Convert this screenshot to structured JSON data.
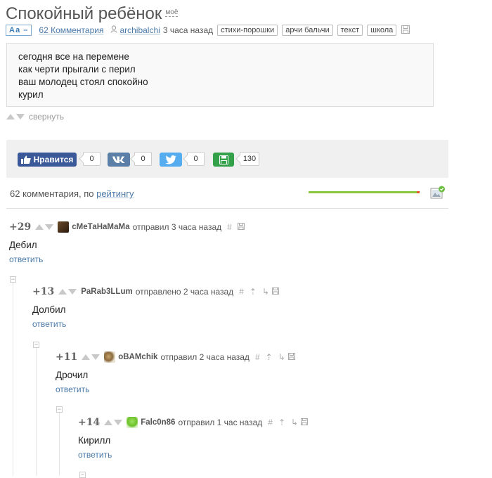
{
  "post": {
    "title": "Спокойный ребёнок",
    "mine_badge": "моё",
    "font_toggle": "Аа",
    "comments_link": "62 Комментария",
    "author": "archibalchi",
    "time": "3 часа назад",
    "tags": [
      "стихи-порошки",
      "арчи бальчи",
      "текст",
      "школа"
    ],
    "lines": [
      "сегодня все на перемене",
      "как черти прыгали с перил",
      "ваш молодец стоял спокойно",
      "курил"
    ],
    "collapse_label": "свернуть"
  },
  "share": {
    "like_label": "Нравится",
    "like_count": "0",
    "vk_count": "0",
    "twitter_count": "0",
    "save_count": "130",
    "colors": {
      "facebook": "#3b5998",
      "vk": "#5b7fa6",
      "twitter": "#55acee",
      "save": "#33a14a"
    }
  },
  "comments_header": {
    "prefix": "62 комментария, по ",
    "sort_label": "рейтингу"
  },
  "comments": [
    {
      "rating": "+29",
      "user": "сМеТаНаМаМа",
      "action": "отправил",
      "time": "3 часа назад",
      "text": "Дебил",
      "reply": "ответить",
      "avatar": "dark-photo-avatar"
    },
    {
      "rating": "+13",
      "user": "PaRab3LLum",
      "action": "отправлено",
      "time": "2 часа назад",
      "text": "Долбил",
      "reply": "ответить",
      "avatar": ""
    },
    {
      "rating": "+11",
      "user": "oBAMchik",
      "action": "отправил",
      "time": "2 часа назад",
      "text": "Дрочил",
      "reply": "ответить",
      "avatar": "cat-avatar"
    },
    {
      "rating": "+14",
      "user": "Falc0n86",
      "action": "отправил",
      "time": "1 час назад",
      "text": "Кирилл",
      "reply": "ответить",
      "avatar": "green-creature-avatar"
    }
  ]
}
